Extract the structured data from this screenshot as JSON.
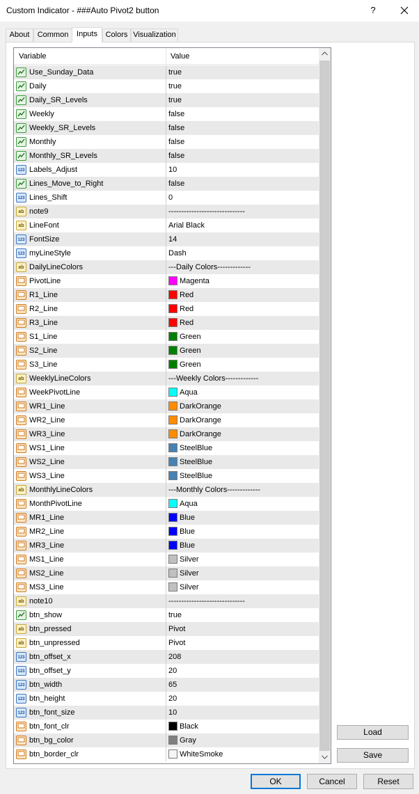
{
  "window": {
    "title": "Custom Indicator - ###Auto Pivot2 button",
    "help_label": "?",
    "close_icon": "close-icon"
  },
  "tabs": [
    {
      "label": "About"
    },
    {
      "label": "Common"
    },
    {
      "label": "Inputs",
      "active": true
    },
    {
      "label": "Colors"
    },
    {
      "label": "Visualization"
    }
  ],
  "grid": {
    "columns": {
      "variable": "Variable",
      "value": "Value"
    },
    "rows": [
      {
        "type": "bool",
        "name": "Use_Sunday_Data",
        "value": "true"
      },
      {
        "type": "bool",
        "name": "Daily",
        "value": "true"
      },
      {
        "type": "bool",
        "name": "Daily_SR_Levels",
        "value": "true"
      },
      {
        "type": "bool",
        "name": "Weekly",
        "value": "false"
      },
      {
        "type": "bool",
        "name": "Weekly_SR_Levels",
        "value": "false"
      },
      {
        "type": "bool",
        "name": "Monthly",
        "value": "false"
      },
      {
        "type": "bool",
        "name": "Monthly_SR_Levels",
        "value": "false"
      },
      {
        "type": "int",
        "name": "Labels_Adjust",
        "value": "10"
      },
      {
        "type": "bool",
        "name": "Lines_Move_to_Right",
        "value": "false"
      },
      {
        "type": "int",
        "name": "Lines_Shift",
        "value": "0"
      },
      {
        "type": "string",
        "name": "note9",
        "value": "------------------------------"
      },
      {
        "type": "string",
        "name": "LineFont",
        "value": "Arial Black"
      },
      {
        "type": "int",
        "name": "FontSize",
        "value": "14"
      },
      {
        "type": "int",
        "name": "myLineStyle",
        "value": "Dash"
      },
      {
        "type": "string",
        "name": "DailyLineColors",
        "value": "---Daily Colors-------------"
      },
      {
        "type": "color",
        "name": "PivotLine",
        "value": "Magenta",
        "color": "#ff00ff"
      },
      {
        "type": "color",
        "name": "R1_Line",
        "value": "Red",
        "color": "#ff0000"
      },
      {
        "type": "color",
        "name": "R2_Line",
        "value": "Red",
        "color": "#ff0000"
      },
      {
        "type": "color",
        "name": "R3_Line",
        "value": "Red",
        "color": "#ff0000"
      },
      {
        "type": "color",
        "name": "S1_Line",
        "value": "Green",
        "color": "#008000"
      },
      {
        "type": "color",
        "name": "S2_Line",
        "value": "Green",
        "color": "#008000"
      },
      {
        "type": "color",
        "name": "S3_Line",
        "value": "Green",
        "color": "#008000"
      },
      {
        "type": "string",
        "name": "WeeklyLineColors",
        "value": "---Weekly Colors-------------"
      },
      {
        "type": "color",
        "name": "WeekPivotLine",
        "value": "Aqua",
        "color": "#00ffff"
      },
      {
        "type": "color",
        "name": "WR1_Line",
        "value": "DarkOrange",
        "color": "#ff8c00"
      },
      {
        "type": "color",
        "name": "WR2_Line",
        "value": "DarkOrange",
        "color": "#ff8c00"
      },
      {
        "type": "color",
        "name": "WR3_Line",
        "value": "DarkOrange",
        "color": "#ff8c00"
      },
      {
        "type": "color",
        "name": "WS1_Line",
        "value": "SteelBlue",
        "color": "#4682b4"
      },
      {
        "type": "color",
        "name": "WS2_Line",
        "value": "SteelBlue",
        "color": "#4682b4"
      },
      {
        "type": "color",
        "name": "WS3_Line",
        "value": "SteelBlue",
        "color": "#4682b4"
      },
      {
        "type": "string",
        "name": "MonthlyLineColors",
        "value": "---Monthly Colors-------------"
      },
      {
        "type": "color",
        "name": "MonthPivotLine",
        "value": "Aqua",
        "color": "#00ffff"
      },
      {
        "type": "color",
        "name": "MR1_Line",
        "value": "Blue",
        "color": "#0000ff"
      },
      {
        "type": "color",
        "name": "MR2_Line",
        "value": "Blue",
        "color": "#0000ff"
      },
      {
        "type": "color",
        "name": "MR3_Line",
        "value": "Blue",
        "color": "#0000ff"
      },
      {
        "type": "color",
        "name": "MS1_Line",
        "value": "Silver",
        "color": "#c0c0c0"
      },
      {
        "type": "color",
        "name": "MS2_Line",
        "value": "Silver",
        "color": "#c0c0c0"
      },
      {
        "type": "color",
        "name": "MS3_Line",
        "value": "Silver",
        "color": "#c0c0c0"
      },
      {
        "type": "string",
        "name": "note10",
        "value": "------------------------------"
      },
      {
        "type": "bool",
        "name": "btn_show",
        "value": "true"
      },
      {
        "type": "string",
        "name": "btn_pressed",
        "value": "Pivot"
      },
      {
        "type": "string",
        "name": "btn_unpressed",
        "value": "Pivot"
      },
      {
        "type": "int",
        "name": "btn_offset_x",
        "value": "208"
      },
      {
        "type": "int",
        "name": "btn_offset_y",
        "value": "20"
      },
      {
        "type": "int",
        "name": "btn_width",
        "value": "65"
      },
      {
        "type": "int",
        "name": "btn_height",
        "value": "20"
      },
      {
        "type": "int",
        "name": "btn_font_size",
        "value": "10"
      },
      {
        "type": "color",
        "name": "btn_font_clr",
        "value": "Black",
        "color": "#000000"
      },
      {
        "type": "color",
        "name": "btn_bg_color",
        "value": "Gray",
        "color": "#808080"
      },
      {
        "type": "color",
        "name": "btn_border_clr",
        "value": "WhiteSmoke",
        "color": "#f5f5f5"
      }
    ]
  },
  "buttons": {
    "load": "Load",
    "save": "Save",
    "ok": "OK",
    "cancel": "Cancel",
    "reset": "Reset"
  },
  "icons": {
    "bool": "boolean-type-icon",
    "int": "integer-type-icon",
    "string": "string-type-icon",
    "color": "color-type-icon"
  },
  "colors": {
    "accent": "#0078d7",
    "row_alt": "#e9e9e9",
    "scrollbar_thumb": "#cdcdcd"
  }
}
